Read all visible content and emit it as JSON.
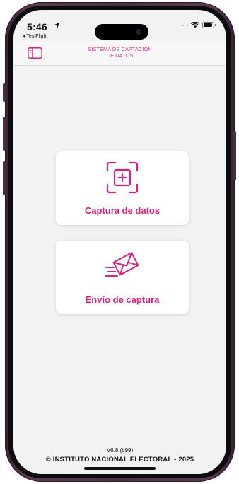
{
  "status_bar": {
    "time": "5:46",
    "back_app": "◂ TestFlight"
  },
  "header": {
    "title_line1": "SISTEMA DE CAPTACIÓN",
    "title_line2": "DE DATOS"
  },
  "menu": {
    "items": [
      {
        "label": "Captura de datos",
        "icon": "scan-plus-icon"
      },
      {
        "label": "Envío de captura",
        "icon": "send-envelope-icon"
      }
    ]
  },
  "footer": {
    "version": "V6.8 (b99)",
    "copyright": "© INSTITUTO NACIONAL ELECTORAL - 2025"
  },
  "colors": {
    "accent": "#d4237f",
    "background": "#f2f2f3",
    "card": "#ffffff"
  }
}
